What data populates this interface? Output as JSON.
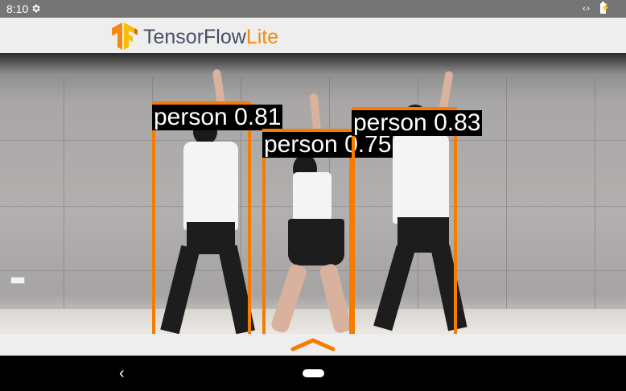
{
  "status_bar": {
    "time": "8:10",
    "icons": [
      "gear-icon",
      "code-icon",
      "battery-charging-icon"
    ],
    "code_glyph": "‹·›",
    "battery_glyph": "⚡"
  },
  "app_bar": {
    "brand_main": "TensorFlow",
    "brand_accent": "Lite",
    "logo": "tensorflow-logo-icon"
  },
  "detections": [
    {
      "label": "person",
      "score": "0.81",
      "text": "person 0.81"
    },
    {
      "label": "person",
      "score": "0.75",
      "text": "person 0.75"
    },
    {
      "label": "person",
      "score": "0.83",
      "text": "person 0.83"
    }
  ],
  "bottom_sheet": {
    "icon": "chevron-up-icon"
  },
  "nav_bar": {
    "back_glyph": "‹",
    "icons": [
      "back-icon",
      "home-icon"
    ]
  },
  "colors": {
    "status_bar": "#757575",
    "app_bar": "#eeeeee",
    "brand_main": "#425066",
    "brand_accent": "#f28a10",
    "box": "#f57c00",
    "label_bg": "#000000",
    "nav_bar": "#000000"
  }
}
